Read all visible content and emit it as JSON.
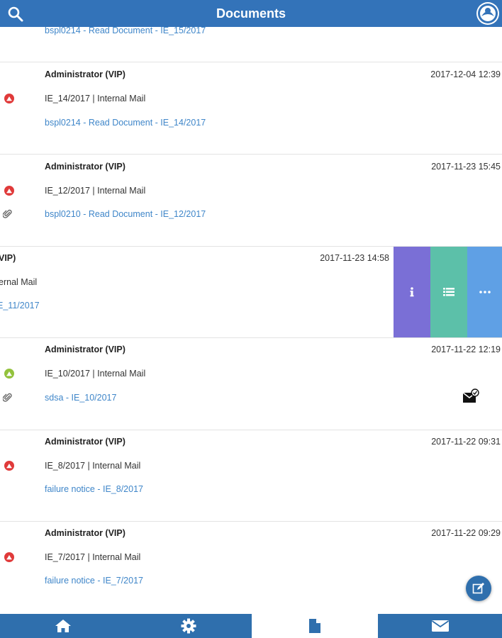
{
  "header": {
    "title": "Documents"
  },
  "rows": [
    {
      "subject": "bspl0214 - Read Document - IE_15/2017"
    },
    {
      "sender": "Administrator (VIP)",
      "date": "2017-12-04 12:39",
      "ref": "IE_14/2017 | Internal Mail",
      "subject": "bspl0214 - Read Document - IE_14/2017",
      "priority": "high",
      "attachment": false
    },
    {
      "sender": "Administrator (VIP)",
      "date": "2017-11-23 15:45",
      "ref": "IE_12/2017 | Internal Mail",
      "subject": "bspl0210 - Read Document - IE_12/2017",
      "priority": "high",
      "attachment": true
    },
    {
      "sender": "VIP)",
      "date": "2017-11-23 14:58",
      "ref": "ernal Mail",
      "subject": "E_11/2017",
      "swiped": true
    },
    {
      "sender": "Administrator (VIP)",
      "date": "2017-11-22 12:19",
      "ref": "IE_10/2017 | Internal Mail",
      "subject": "sdsa - IE_10/2017",
      "priority": "normal",
      "attachment": true,
      "status_icon": "mail-signed-icon"
    },
    {
      "sender": "Administrator (VIP)",
      "date": "2017-11-22 09:31",
      "ref": "IE_8/2017 | Internal Mail",
      "subject": "failure notice - IE_8/2017",
      "priority": "high",
      "attachment": false
    },
    {
      "sender": "Administrator (VIP)",
      "date": "2017-11-22 09:29",
      "ref": "IE_7/2017 | Internal Mail",
      "subject": "failure notice - IE_7/2017",
      "priority": "high",
      "attachment": false
    }
  ],
  "swipe_actions": [
    "info-icon",
    "list-icon",
    "more-icon"
  ],
  "bottom_nav": {
    "tabs": [
      "home-icon",
      "gear-icon",
      "document-icon",
      "mail-icon"
    ],
    "active": "document-icon"
  },
  "colors": {
    "brand": "#3373b9",
    "link": "#3f86c9",
    "priority_high": "#e03a3a",
    "priority_normal": "#93c23d",
    "action_info": "#7a6fd6",
    "action_list": "#5cc0a9",
    "action_more": "#5fa0e5"
  }
}
